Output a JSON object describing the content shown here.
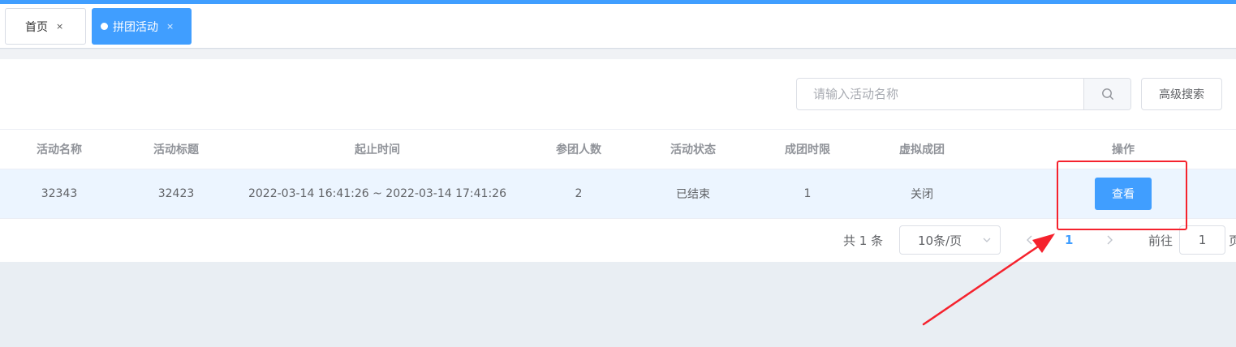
{
  "tabs": [
    {
      "label": "首页",
      "close": "×"
    },
    {
      "label": "拼团活动",
      "close": "×"
    }
  ],
  "search": {
    "placeholder": "请输入活动名称",
    "advanced_label": "高级搜索"
  },
  "table": {
    "headers": [
      "活动名称",
      "活动标题",
      "起止时间",
      "参团人数",
      "活动状态",
      "成团时限",
      "虚拟成团",
      "操作"
    ],
    "rows": [
      {
        "name": "32343",
        "title": "32423",
        "time": "2022-03-14 16:41:26 ~ 2022-03-14 17:41:26",
        "participants": "2",
        "status": "已结束",
        "limit": "1",
        "virtual": "关闭",
        "action": "查看"
      }
    ]
  },
  "pagination": {
    "total": "共 1 条",
    "page_size": "10条/页",
    "current": "1",
    "goto": "前往",
    "goto_value": "1",
    "page_suffix": "页"
  },
  "colors": {
    "primary": "#409eff",
    "annotation": "#f5222d"
  }
}
